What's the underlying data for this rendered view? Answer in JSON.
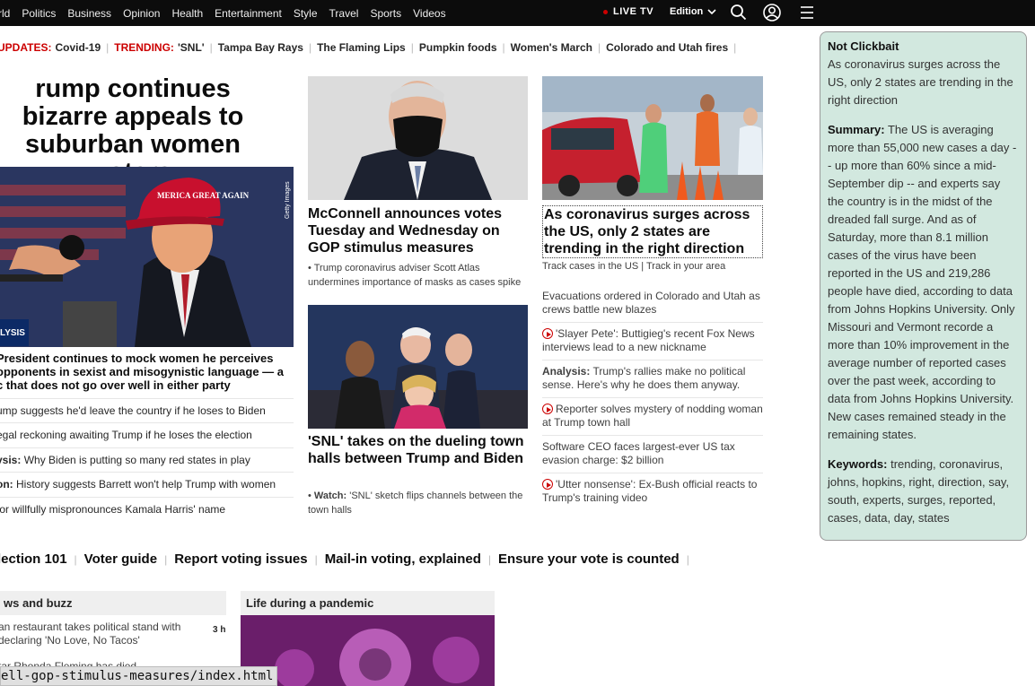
{
  "nav": {
    "links": [
      "rld",
      "Politics",
      "Business",
      "Opinion",
      "Health",
      "Entertainment",
      "Style",
      "Travel",
      "Sports",
      "Videos"
    ],
    "live_tv": "LIVE TV",
    "edition": "Edition"
  },
  "trending": {
    "updates_label": "UPDATES:",
    "updates_topic": "Covid-19",
    "trending_label": "TRENDING:",
    "topics": [
      "'SNL'",
      "Tampa Bay Rays",
      "The Flaming Lips",
      "Pumpkin foods",
      "Women's March",
      "Colorado and Utah fires"
    ]
  },
  "lead": {
    "headline": "rump continues bizarre appeals to suburban women voters",
    "tag": "LYSIS",
    "image_credit": "Getty Images",
    "hat_text": "MERICA GREAT AGAIN",
    "subhead": "President continues to mock women he perceives opponents in sexist and misogynistic language — a c that does not go over well in either party",
    "list": [
      {
        "prefix": "",
        "text": "ump suggests he'd leave the country if he loses to Biden"
      },
      {
        "prefix": "",
        "text": "egal reckoning awaiting Trump if he loses the election"
      },
      {
        "prefix": "ysis:",
        "text": " Why Biden is putting so many red states in play"
      },
      {
        "prefix": "on:",
        "text": " History suggests Barrett won't help Trump with women"
      },
      {
        "prefix": "",
        "text": "tor willfully mispronounces Kamala Harris' name"
      }
    ]
  },
  "middle": {
    "story1": {
      "headline": "McConnell announces votes Tuesday and Wednesday on GOP stimulus measures",
      "bullet": "Trump coronavirus adviser Scott Atlas undermines importance of masks as cases spike"
    },
    "story2": {
      "headline": "'SNL' takes on the dueling town halls between Trump and Biden",
      "watch_label": "Watch:",
      "bullet": " 'SNL' sketch flips channels between the town halls"
    }
  },
  "right": {
    "headline": "As coronavirus surges across the US, only 2 states are trending in the right direction",
    "links": [
      "Track cases in the US",
      "Track in your area"
    ],
    "list": [
      {
        "video": false,
        "prefix": "",
        "text": "Evacuations ordered in Colorado and Utah as crews battle new blazes"
      },
      {
        "video": true,
        "prefix": "",
        "text": "'Slayer Pete': Buttigieg's recent Fox News interviews lead to a new nickname"
      },
      {
        "video": false,
        "prefix": "Analysis:",
        "text": " Trump's rallies make no political sense. Here's why he does them anyway."
      },
      {
        "video": true,
        "prefix": "",
        "text": "Reporter solves mystery of nodding woman at Trump town hall"
      },
      {
        "video": false,
        "prefix": "",
        "text": "Software CEO faces largest-ever US tax evasion charge: $2 billion"
      },
      {
        "video": true,
        "prefix": "",
        "text": "'Utter nonsense': Ex-Bush official reacts to Trump's training video"
      }
    ]
  },
  "election": [
    "lection 101",
    "Voter guide",
    "Report voting issues",
    "Mail-in voting, explained",
    "Ensure your vote is counted"
  ],
  "sections": {
    "news_buzz": {
      "title": "ws and buzz",
      "item1": "an restaurant takes political stand with declaring 'No Love, No Tacos'",
      "item1_time": "3 h",
      "item2": "tar Rhonda Fleming has died"
    },
    "pandemic": {
      "title": "Life during a pandemic"
    }
  },
  "status_url": "ell-gop-stimulus-measures/index.html",
  "panel": {
    "title": "Not Clickbait",
    "title_text": "As coronavirus surges across the US, only 2 states are trending in the right direction",
    "summary_label": "Summary:",
    "summary": " The US is averaging more than 55,000 new cases a day -- up more than 60% since a mid-September dip -- and experts say the country is in the midst of the dreaded fall surge. And as of Saturday, more than 8.1 million cases of the virus have been reported in the US and 219,286 people have died, according to data from Johns Hopkins University. Only Missouri and Vermont recorde a more than 10% improvement in the average number of reported cases over the past week, according to data from Johns Hopkins University. New cases remained steady in the remaining states.",
    "keywords_label": "Keywords:",
    "keywords": " trending, coronavirus, johns, hopkins, right, direction, say, south, experts, surges, reported, cases, data, day, states"
  },
  "colors": {
    "accent_red": "#cc0000",
    "panel_bg": "#d2e8df",
    "topbar": "#0c0c0c"
  }
}
